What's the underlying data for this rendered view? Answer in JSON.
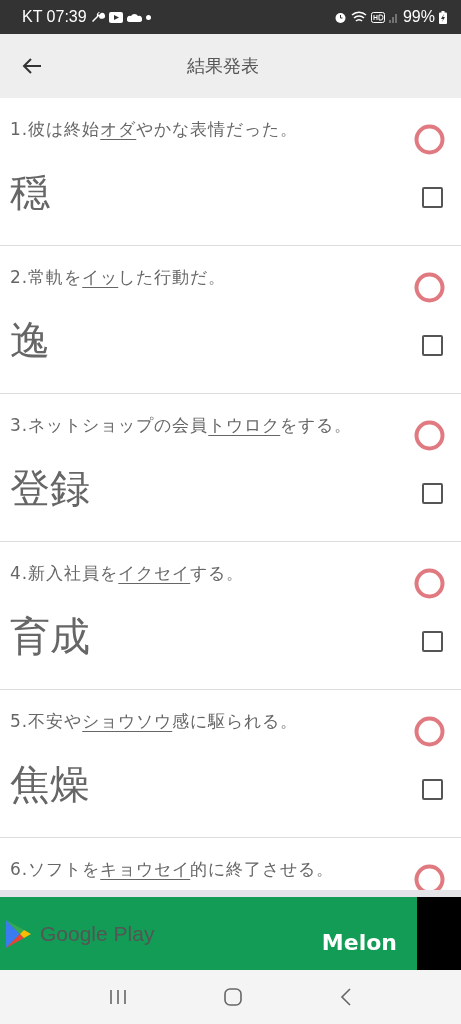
{
  "status_bar": {
    "carrier_time": "KT 07:39",
    "battery": "99%"
  },
  "header": {
    "title": "結果発表"
  },
  "questions": [
    {
      "number": "1.",
      "before": "彼は終始",
      "target": "オダ",
      "after": "やかな表情だった。",
      "answer": "穏",
      "correct": true,
      "checked": false
    },
    {
      "number": "2.",
      "before": "常軌を",
      "target": "イッ",
      "after": "した行動だ。",
      "answer": "逸",
      "correct": true,
      "checked": false
    },
    {
      "number": "3.",
      "before": "ネットショップの会員",
      "target": "トウロク",
      "after": "をする。",
      "answer": "登録",
      "correct": true,
      "checked": false
    },
    {
      "number": "4.",
      "before": "新入社員を",
      "target": "イクセイ",
      "after": "する。",
      "answer": "育成",
      "correct": true,
      "checked": false
    },
    {
      "number": "5.",
      "before": "不安や",
      "target": "ショウソウ",
      "after": "感に駆られる。",
      "answer": "焦燥",
      "correct": true,
      "checked": false
    },
    {
      "number": "6.",
      "before": "ソフトを",
      "target": "キョウセイ",
      "after": "的に終了させる。",
      "correct": true
    }
  ],
  "ad": {
    "store": "Google Play",
    "brand": "Melon"
  }
}
